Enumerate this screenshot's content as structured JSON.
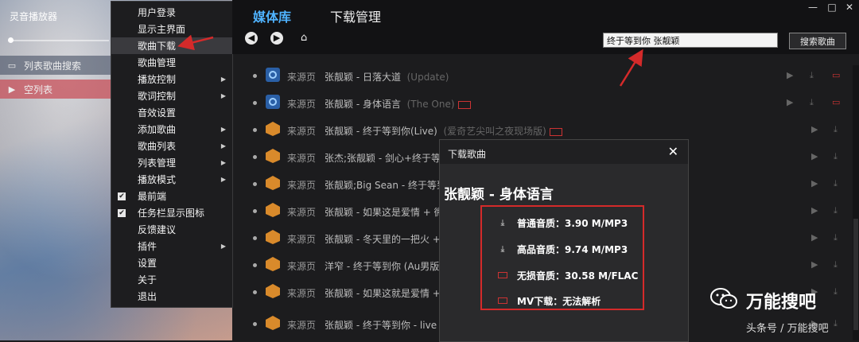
{
  "app_title": "灵音播放器",
  "sidebar": {
    "search_label": "列表歌曲搜索",
    "list_label": "空列表"
  },
  "menu": {
    "items": [
      {
        "label": "用户登录"
      },
      {
        "label": "显示主界面"
      },
      {
        "label": "歌曲下载"
      },
      {
        "label": "歌曲管理"
      },
      {
        "label": "播放控制"
      },
      {
        "label": "歌词控制"
      },
      {
        "label": "音效设置"
      },
      {
        "label": "添加歌曲"
      },
      {
        "label": "歌曲列表"
      },
      {
        "label": "列表管理"
      },
      {
        "label": "播放模式"
      },
      {
        "label": "最前端"
      },
      {
        "label": "任务栏显示图标"
      },
      {
        "label": "反馈建议"
      },
      {
        "label": "插件"
      },
      {
        "label": "设置"
      },
      {
        "label": "关于"
      },
      {
        "label": "退出"
      }
    ]
  },
  "header": {
    "tab_media": "媒体库",
    "tab_download": "下载管理",
    "search_value": "终于等到你 张靓颖",
    "search_button": "搜索歌曲"
  },
  "songs": [
    {
      "source": "来源页",
      "title": "张靓颖 - 日落大道",
      "extra": "(Update)"
    },
    {
      "source": "来源页",
      "title": "张靓颖 - 身体语言",
      "extra": "(The One)"
    },
    {
      "source": "来源页",
      "title": "张靓颖 - 终于等到你(Live)",
      "extra": "(爱奇艺尖叫之夜现场版)"
    },
    {
      "source": "来源页",
      "title": "张杰;张靓颖 - 剑心+终于等",
      "extra": ""
    },
    {
      "source": "来源页",
      "title": "张靓颖;Big Sean - 终于等到",
      "extra": ""
    },
    {
      "source": "来源页",
      "title": "张靓颖 - 如果这是爱情 + 微",
      "extra": ""
    },
    {
      "source": "来源页",
      "title": "张靓颖 - 冬天里的一把火 +",
      "extra": ""
    },
    {
      "source": "来源页",
      "title": "洋窄 - 终于等到你 (Au男版",
      "extra": ""
    },
    {
      "source": "来源页",
      "title": "张靓颖 - 如果这就是爱情 +",
      "extra": ""
    },
    {
      "source": "来源页",
      "title": "张靓颖 - 终于等到你 - live",
      "extra": ""
    }
  ],
  "dialog": {
    "title": "下载歌曲",
    "song": "张靓颖 - 身体语言",
    "options": [
      {
        "label": "普通音质：3.90 M/MP3"
      },
      {
        "label": "高品音质：9.74 M/MP3"
      },
      {
        "label": "无损音质：30.58 M/FLAC"
      },
      {
        "label": "MV下载：无法解析"
      }
    ]
  },
  "watermark": {
    "name": "万能搜吧",
    "sub": "头条号 / 万能搜吧"
  }
}
